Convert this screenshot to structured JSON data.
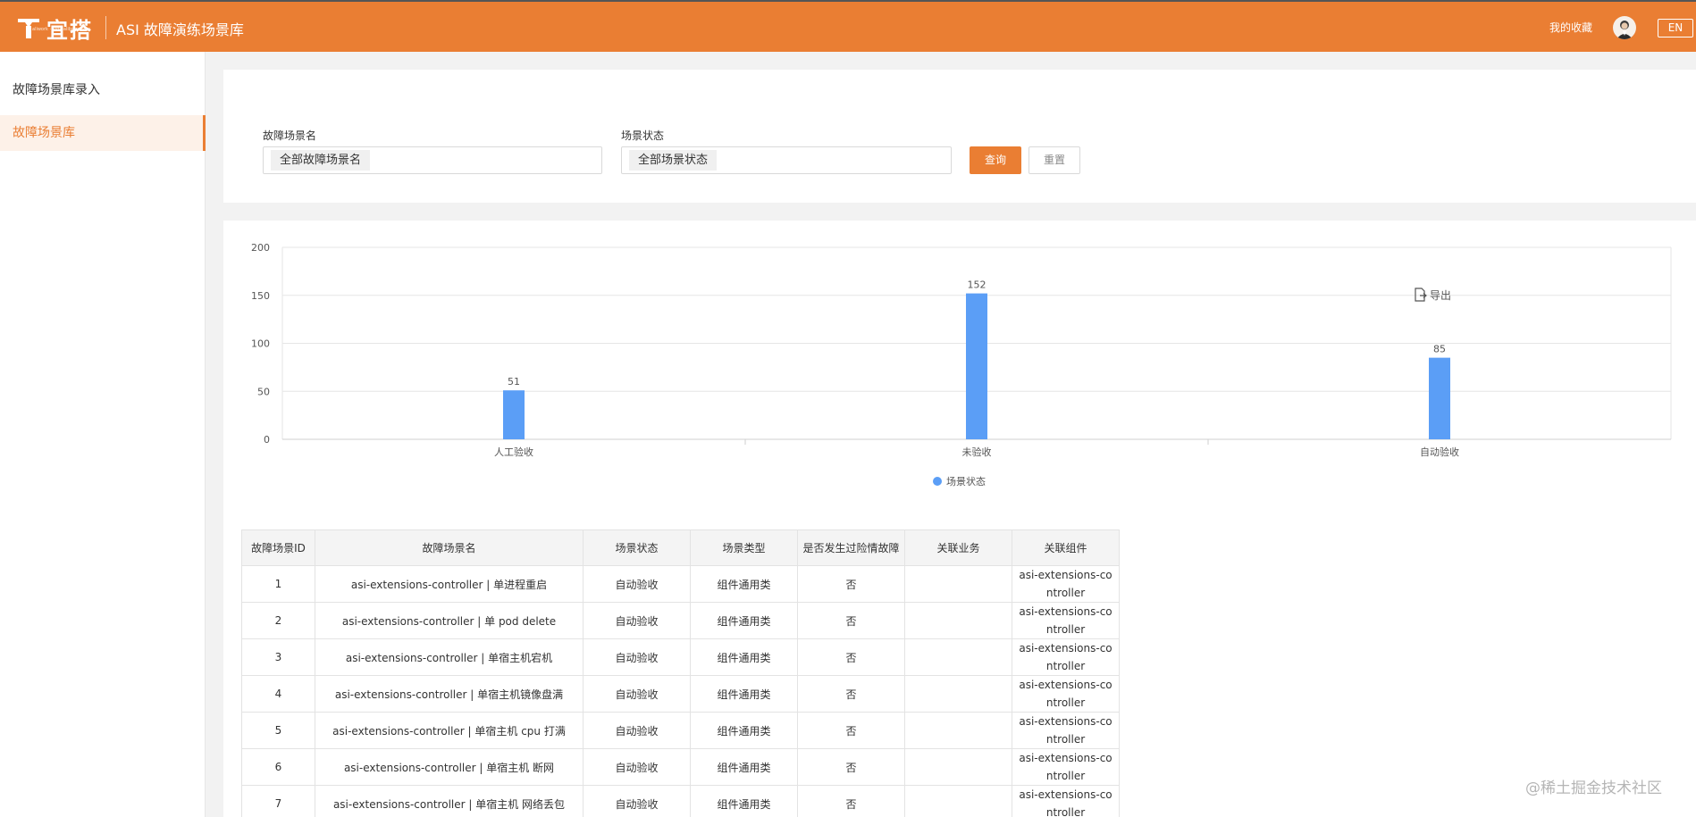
{
  "header": {
    "logo_text": "宜搭",
    "logo_sub": "aliwork · yida.alibaba.com",
    "app_title": "ASI 故障演练场景库",
    "favorites_label": "我的收藏",
    "lang_label": "EN"
  },
  "sidebar": {
    "items": [
      {
        "label": "故障场景库录入",
        "active": false
      },
      {
        "label": "故障场景库",
        "active": true
      }
    ]
  },
  "filters": {
    "scene_name": {
      "label": "故障场景名",
      "value": "全部故障场景名"
    },
    "scene_status": {
      "label": "场景状态",
      "value": "全部场景状态"
    },
    "query_label": "查询",
    "reset_label": "重置"
  },
  "chart_data": {
    "type": "bar",
    "categories": [
      "人工验收",
      "未验收",
      "自动验收"
    ],
    "series": [
      {
        "name": "场景状态",
        "values": [
          51,
          152,
          85
        ],
        "color": "#5b9ef6"
      }
    ],
    "ylim": [
      0,
      200
    ],
    "yticks": [
      0,
      50,
      100,
      150,
      200
    ],
    "grid": true,
    "legend_position": "bottom-center"
  },
  "export_label": "导出",
  "table": {
    "columns": [
      "故障场景ID",
      "故障场景名",
      "场景状态",
      "场景类型",
      "是否发生过险情故障",
      "关联业务",
      "关联组件"
    ],
    "rows": [
      [
        "1",
        "asi-extensions-controller | 单进程重启",
        "自动验收",
        "组件通用类",
        "否",
        "",
        "asi-extensions-controller"
      ],
      [
        "2",
        "asi-extensions-controller | 单 pod delete",
        "自动验收",
        "组件通用类",
        "否",
        "",
        "asi-extensions-controller"
      ],
      [
        "3",
        "asi-extensions-controller | 单宿主机宕机",
        "自动验收",
        "组件通用类",
        "否",
        "",
        "asi-extensions-controller"
      ],
      [
        "4",
        "asi-extensions-controller | 单宿主机镜像盘满",
        "自动验收",
        "组件通用类",
        "否",
        "",
        "asi-extensions-controller"
      ],
      [
        "5",
        "asi-extensions-controller | 单宿主机 cpu 打满",
        "自动验收",
        "组件通用类",
        "否",
        "",
        "asi-extensions-controller"
      ],
      [
        "6",
        "asi-extensions-controller | 单宿主机 断网",
        "自动验收",
        "组件通用类",
        "否",
        "",
        "asi-extensions-controller"
      ],
      [
        "7",
        "asi-extensions-controller | 单宿主机 网络丢包",
        "自动验收",
        "组件通用类",
        "否",
        "",
        "asi-extensions-controller"
      ]
    ]
  },
  "watermark": "@稀土掘金技术社区",
  "colors": {
    "accent": "#ea7e33",
    "bar": "#5b9ef6"
  }
}
